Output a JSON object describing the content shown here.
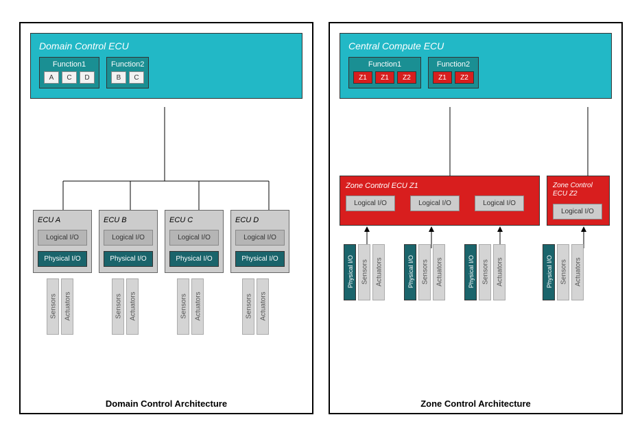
{
  "left": {
    "caption": "Domain Control Architecture",
    "topTitle": "Domain Control ECU",
    "functions": [
      {
        "name": "Function1",
        "items": [
          "A",
          "C",
          "D"
        ],
        "style": "white"
      },
      {
        "name": "Function2",
        "items": [
          "B",
          "C"
        ],
        "style": "white"
      }
    ],
    "ecus": [
      {
        "name": "ECU A"
      },
      {
        "name": "ECU B"
      },
      {
        "name": "ECU C"
      },
      {
        "name": "ECU D"
      }
    ],
    "logical": "Logical I/O",
    "physical": "Physical I/O",
    "sensors": "Sensors",
    "actuators": "Actuators"
  },
  "right": {
    "caption": "Zone Control Architecture",
    "topTitle": "Central Compute ECU",
    "functions": [
      {
        "name": "Function1",
        "items": [
          "Z1",
          "Z1",
          "Z2"
        ],
        "style": "red"
      },
      {
        "name": "Function2",
        "items": [
          "Z1",
          "Z2"
        ],
        "style": "red"
      }
    ],
    "zones": [
      {
        "name": "Zone Control ECU Z1",
        "logicalCount": 3
      },
      {
        "name": "Zone Control ECU Z2",
        "logicalCount": 1
      }
    ],
    "logical": "Logical I/O",
    "physical": "Physical I/O",
    "sensors": "Sensors",
    "actuators": "Actuators"
  }
}
